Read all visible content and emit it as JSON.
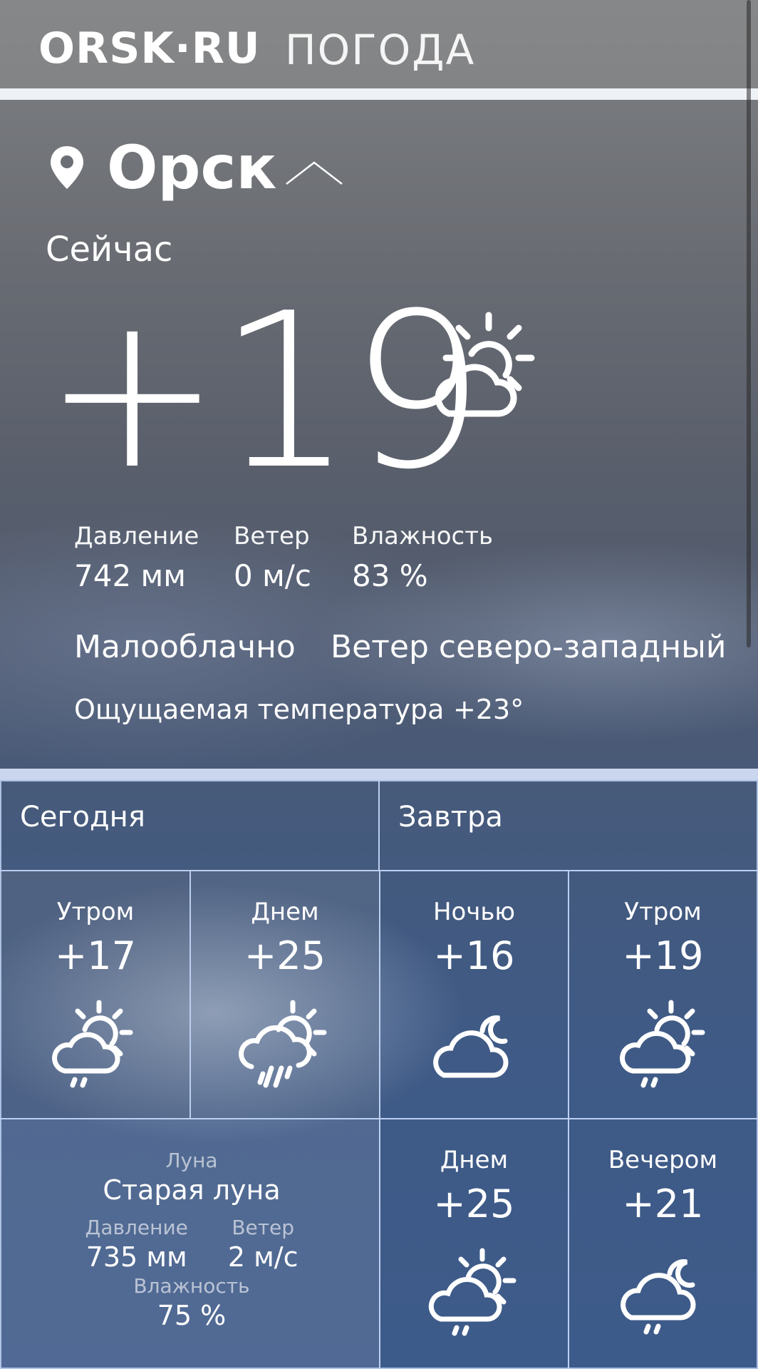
{
  "header": {
    "logo": "ORSK·RU",
    "section": "ПОГОДА"
  },
  "location": {
    "city": "Орск"
  },
  "current": {
    "label": "Сейчас",
    "temperature": "+19",
    "icon": "partly-cloudy-sun-icon",
    "stats": [
      {
        "label": "Давление",
        "value": "742 мм"
      },
      {
        "label": "Ветер",
        "value": "0 м/с"
      },
      {
        "label": "Влажность",
        "value": "83 %"
      }
    ],
    "condition": "Малооблачно",
    "wind_direction": "Ветер северо-западный",
    "feels_like_label": "Ощущаемая температура",
    "feels_like_value": "+23°"
  },
  "forecast": {
    "today_label": "Сегодня",
    "tomorrow_label": "Завтра",
    "periods": [
      {
        "title": "Утром",
        "temp": "+17",
        "icon": "sun-cloud-light-rain-icon"
      },
      {
        "title": "Днем",
        "temp": "+25",
        "icon": "sun-cloud-rain-icon"
      },
      {
        "title": "Ночью",
        "temp": "+16",
        "icon": "moon-cloud-icon"
      },
      {
        "title": "Утром",
        "temp": "+19",
        "icon": "sun-cloud-light-rain-icon"
      },
      {
        "title": "Днем",
        "temp": "+25",
        "icon": "sun-cloud-light-rain-icon"
      },
      {
        "title": "Вечером",
        "temp": "+21",
        "icon": "moon-cloud-light-rain-icon"
      }
    ],
    "moon": {
      "label": "Луна",
      "phase": "Старая луна",
      "pressure_label": "Давление",
      "pressure": "735 мм",
      "wind_label": "Ветер",
      "wind": "2 м/с",
      "humidity_label": "Влажность",
      "humidity": "75 %"
    }
  }
}
